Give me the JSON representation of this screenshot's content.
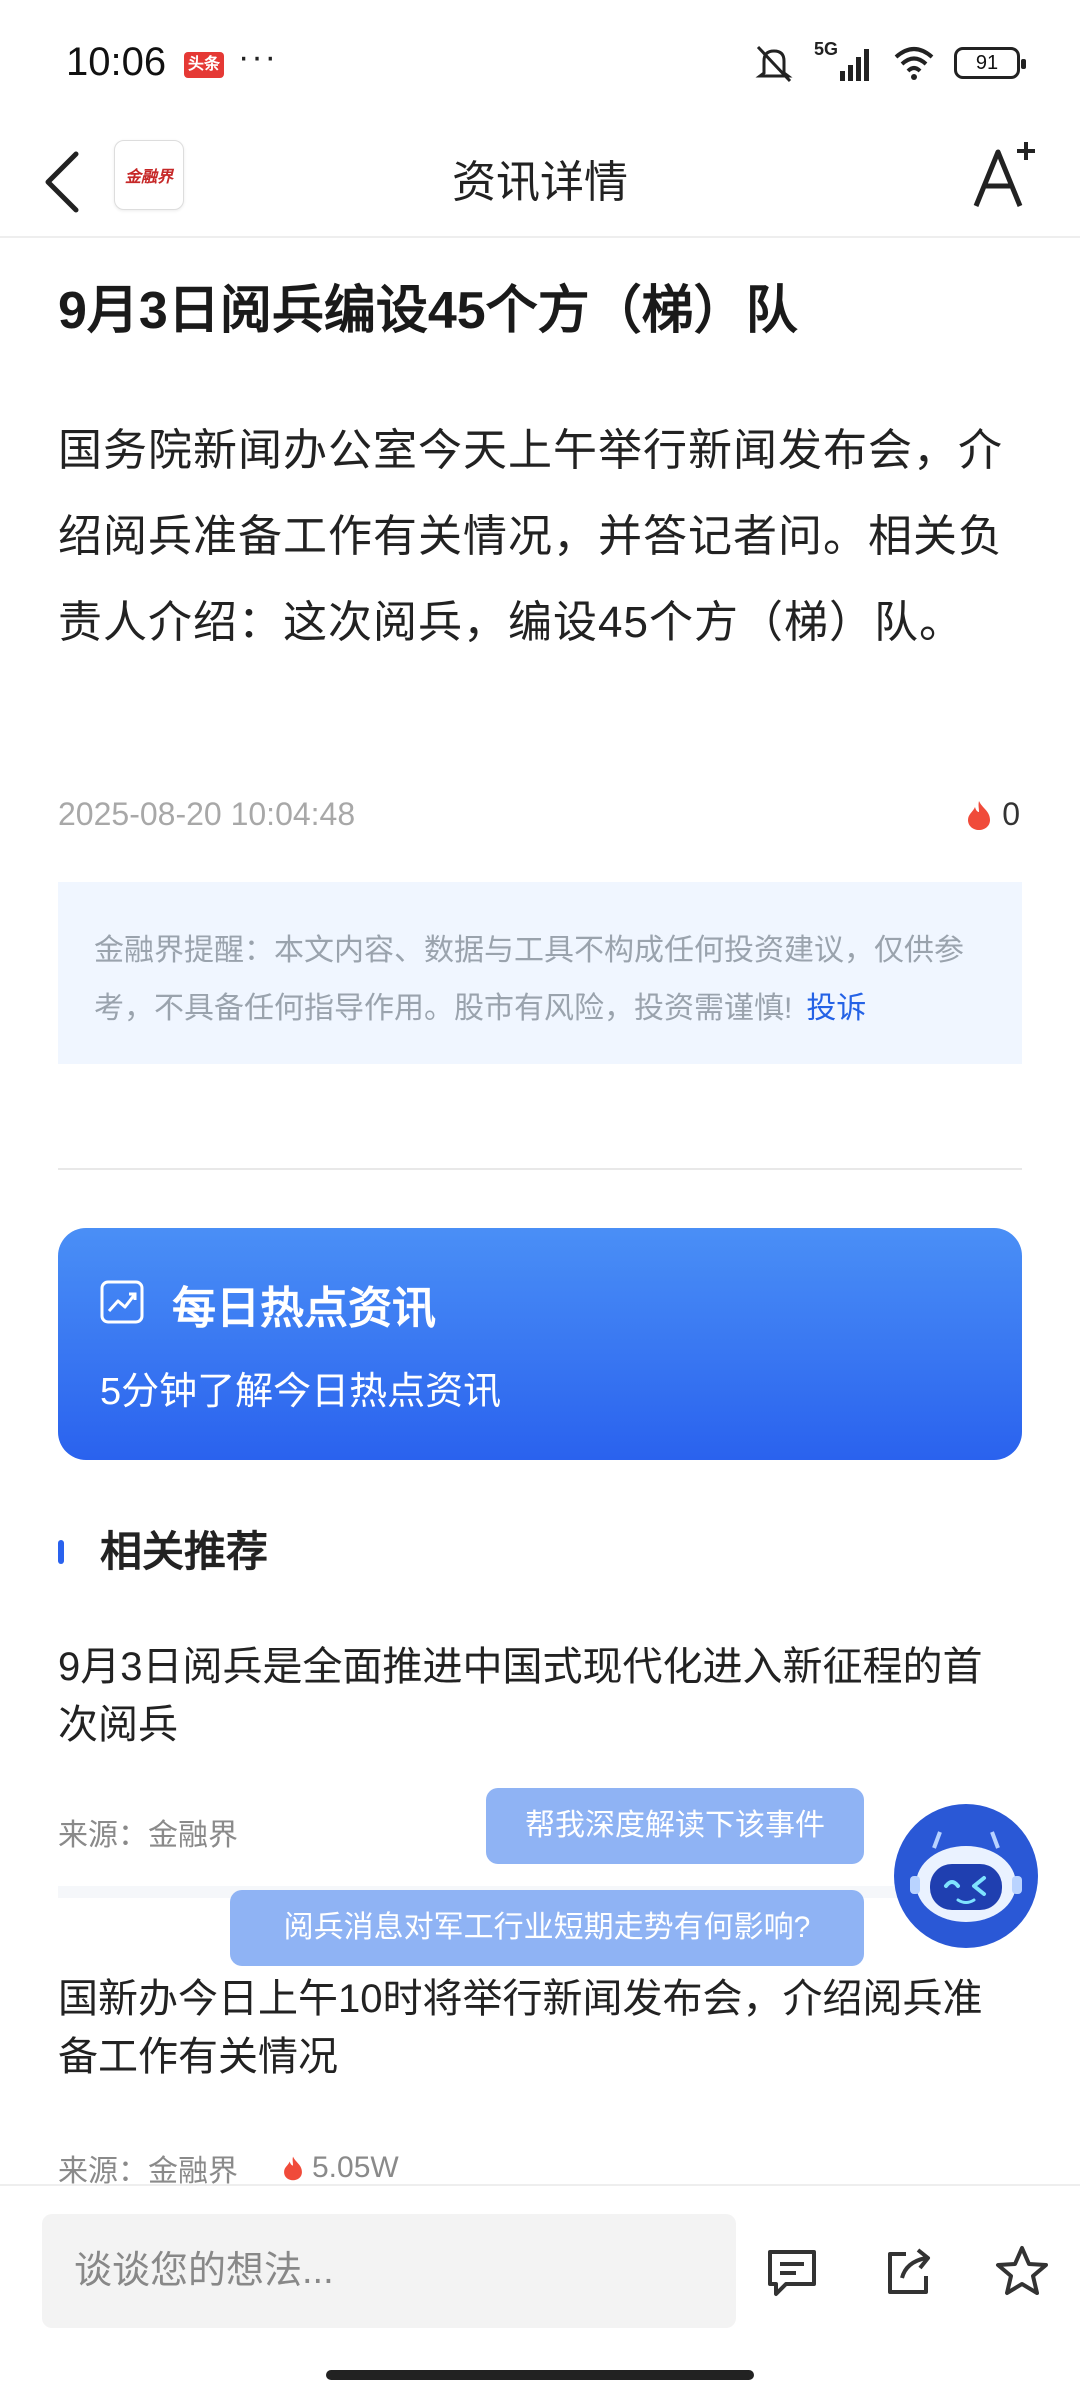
{
  "status_bar": {
    "time": "10:06",
    "app_badge": "头条",
    "more": "···",
    "network": "5G",
    "battery": "91"
  },
  "header": {
    "logo_text": "金融界",
    "title": "资讯详情"
  },
  "article": {
    "title": "9月3日阅兵编设45个方（梯）队",
    "body": "国务院新闻办公室今天上午举行新闻发布会，介绍阅兵准备工作有关情况，并答记者问。相关负责人介绍：这次阅兵，编设45个方（梯）队。",
    "datetime": "2025-08-20 10:04:48",
    "hot_count": "0"
  },
  "disclaimer": {
    "text": "金融界提醒：本文内容、数据与工具不构成任何投资建议，仅供参考，不具备任何指导作用。股市有风险，投资需谨慎!",
    "complain_link": "投诉"
  },
  "banner": {
    "title": "每日热点资讯",
    "subtitle": "5分钟了解今日热点资讯"
  },
  "related": {
    "heading": "相关推荐",
    "items": [
      {
        "title": "9月3日阅兵是全面推进中国式现代化进入新征程的首次阅兵",
        "source": "来源：金融界"
      },
      {
        "title": "国新办今日上午10时将举行新闻发布会，介绍阅兵准备工作有关情况",
        "source": "来源：金融界",
        "hot": "5.05W"
      }
    ]
  },
  "ai_assistant": {
    "chips": [
      "帮我深度解读下该事件",
      "阅兵消息对军工行业短期走势有何影响?"
    ]
  },
  "bottom_bar": {
    "comment_placeholder": "谈谈您的想法..."
  },
  "colors": {
    "accent": "#2a62ee",
    "chip": "#8fb3f4",
    "disclaimer_bg": "#f0f6ff",
    "hot": "#f04b3a"
  }
}
